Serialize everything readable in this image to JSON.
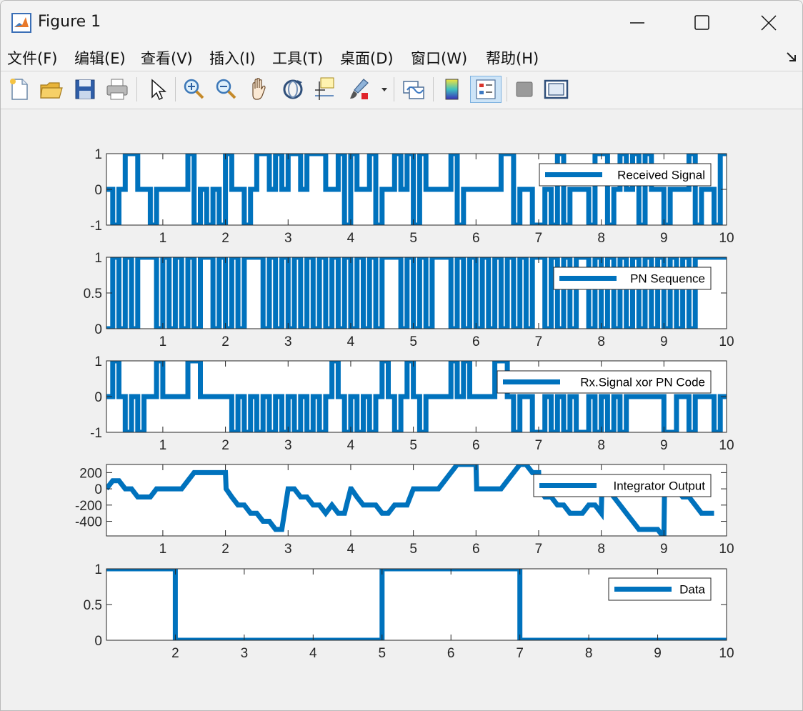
{
  "window": {
    "title": "Figure 1",
    "minimize_icon": "minimize-icon",
    "maximize_icon": "maximize-icon",
    "close_icon": "close-icon"
  },
  "menubar": {
    "items": [
      {
        "label": "文件(F)"
      },
      {
        "label": "编辑(E)"
      },
      {
        "label": "查看(V)"
      },
      {
        "label": "插入(I)"
      },
      {
        "label": "工具(T)"
      },
      {
        "label": "桌面(D)"
      },
      {
        "label": "窗口(W)"
      },
      {
        "label": "帮助(H)"
      }
    ]
  },
  "toolbar": {
    "buttons": [
      {
        "name": "new-figure-icon"
      },
      {
        "name": "open-file-icon"
      },
      {
        "name": "save-icon"
      },
      {
        "name": "print-icon"
      },
      {
        "name": "edit-plot-arrow-icon"
      },
      {
        "name": "zoom-in-icon"
      },
      {
        "name": "zoom-out-icon"
      },
      {
        "name": "pan-hand-icon"
      },
      {
        "name": "rotate-3d-icon"
      },
      {
        "name": "data-cursor-icon"
      },
      {
        "name": "brush-icon"
      },
      {
        "name": "link-plot-icon"
      },
      {
        "name": "colorbar-icon"
      },
      {
        "name": "legend-icon"
      },
      {
        "name": "hide-plot-tools-icon"
      },
      {
        "name": "show-plot-tools-icon"
      }
    ]
  },
  "colors": {
    "line": "#0072bd",
    "axes_bg": "#ffffff",
    "figure_bg": "#f0f0f0",
    "axis_color": "#262626"
  },
  "chart_data": [
    {
      "type": "line",
      "legend": "Received Signal",
      "legend_position": "top-right",
      "xlim": [
        0.1,
        10
      ],
      "ylim": [
        -1,
        1
      ],
      "xticks": [
        1,
        2,
        3,
        4,
        5,
        6,
        7,
        8,
        9,
        10
      ],
      "yticks": [
        -1,
        0,
        1
      ],
      "ytick_labels": [
        "-1",
        "0",
        "1"
      ],
      "x": [
        0.1,
        0.2,
        0.3,
        0.4,
        0.5,
        0.6,
        0.7,
        0.8,
        0.9,
        1.0,
        1.1,
        1.2,
        1.3,
        1.4,
        1.5,
        1.6,
        1.7,
        1.8,
        1.9,
        2.0,
        2.1,
        2.2,
        2.3,
        2.4,
        2.5,
        2.6,
        2.7,
        2.8,
        2.9,
        3.0,
        3.1,
        3.2,
        3.3,
        3.4,
        3.5,
        3.6,
        3.7,
        3.8,
        3.9,
        4.0,
        4.1,
        4.2,
        4.3,
        4.4,
        4.5,
        4.6,
        4.7,
        4.8,
        4.9,
        5.0,
        5.1,
        5.2,
        5.3,
        5.4,
        5.5,
        5.6,
        5.7,
        5.8,
        5.9,
        6.0,
        6.1,
        6.2,
        6.3,
        6.4,
        6.5,
        6.6,
        6.7,
        6.8,
        6.9,
        7.0,
        7.1,
        7.2,
        7.3,
        7.4,
        7.5,
        7.6,
        7.7,
        7.8,
        7.9,
        8.0,
        8.1,
        8.2,
        8.3,
        8.4,
        8.5,
        8.6,
        8.7,
        8.8,
        8.9,
        9.0,
        9.1,
        9.2,
        9.3,
        9.4,
        9.5,
        9.6,
        9.7,
        9.8,
        9.9,
        10.0
      ],
      "y": [
        0,
        -1,
        0,
        1,
        1,
        0,
        0,
        -1,
        0,
        0,
        0,
        0,
        0,
        1,
        -1,
        0,
        -1,
        0,
        -1,
        1,
        0,
        0,
        -1,
        0,
        1,
        1,
        0,
        1,
        0,
        1,
        1,
        0,
        1,
        1,
        1,
        0,
        0,
        1,
        -1,
        1,
        0,
        0,
        1,
        -1,
        0,
        0,
        1,
        0,
        1,
        -1,
        1,
        0,
        0,
        0,
        0,
        1,
        -1,
        0,
        0,
        0,
        0,
        0,
        0,
        1,
        1,
        -1,
        0,
        0,
        -1,
        -1,
        0,
        -1,
        1,
        -1,
        0,
        0,
        0,
        -1,
        1,
        1,
        -1,
        0,
        1,
        0,
        1,
        -1,
        1,
        0,
        0,
        -1,
        0,
        0,
        0,
        1,
        -1,
        0,
        0,
        -1,
        1,
        1
      ]
    },
    {
      "type": "line",
      "legend": "PN Sequence",
      "legend_position": "top-right",
      "xlim": [
        0.1,
        10
      ],
      "ylim": [
        0,
        1
      ],
      "xticks": [
        1,
        2,
        3,
        4,
        5,
        6,
        7,
        8,
        9,
        10
      ],
      "yticks": [
        0,
        0.5,
        1
      ],
      "ytick_labels": [
        "0",
        "0.5",
        "1"
      ],
      "x": [
        0.1,
        0.2,
        0.3,
        0.4,
        0.5,
        0.6,
        0.7,
        0.8,
        0.9,
        1.0,
        1.1,
        1.2,
        1.3,
        1.4,
        1.5,
        1.6,
        1.7,
        1.8,
        1.9,
        2.0,
        2.1,
        2.2,
        2.3,
        2.4,
        2.5,
        2.6,
        2.7,
        2.8,
        2.9,
        3.0,
        3.1,
        3.2,
        3.3,
        3.4,
        3.5,
        3.6,
        3.7,
        3.8,
        3.9,
        4.0,
        4.1,
        4.2,
        4.3,
        4.4,
        4.5,
        4.6,
        4.7,
        4.8,
        4.9,
        5.0,
        5.1,
        5.2,
        5.3,
        5.4,
        5.5,
        5.6,
        5.7,
        5.8,
        5.9,
        6.0,
        6.1,
        6.2,
        6.3,
        6.4,
        6.5,
        6.6,
        6.7,
        6.8,
        6.9,
        7.0,
        7.1,
        7.2,
        7.3,
        7.4,
        7.5,
        7.6,
        7.7,
        7.8,
        7.9,
        8.0,
        8.1,
        8.2,
        8.3,
        8.4,
        8.5,
        8.6,
        8.7,
        8.8,
        8.9,
        9.0,
        9.1,
        9.2,
        9.3,
        9.4,
        9.5,
        9.6,
        9.7,
        9.8,
        9.9,
        10.0
      ],
      "y": [
        0,
        1,
        0,
        1,
        0,
        1,
        1,
        1,
        0,
        1,
        0,
        1,
        0,
        1,
        0,
        1,
        1,
        0,
        1,
        0,
        1,
        0,
        1,
        1,
        1,
        0,
        1,
        0,
        1,
        0,
        1,
        0,
        1,
        0,
        1,
        0,
        1,
        0,
        1,
        0,
        1,
        0,
        1,
        0,
        1,
        1,
        1,
        0,
        1,
        0,
        1,
        0,
        1,
        1,
        1,
        0,
        1,
        0,
        1,
        0,
        1,
        0,
        1,
        0,
        1,
        0,
        1,
        0,
        1,
        1,
        0,
        1,
        0,
        1,
        0,
        1,
        1,
        0,
        1,
        0,
        1,
        0,
        1,
        0,
        1,
        0,
        1,
        0,
        1,
        0,
        1,
        0,
        1,
        0,
        1,
        1,
        1,
        1,
        1,
        1
      ]
    },
    {
      "type": "line",
      "legend": "Rx.Signal xor PN Code",
      "legend_position": "top-right",
      "xlim": [
        0.1,
        10
      ],
      "ylim": [
        -1,
        1
      ],
      "xticks": [
        1,
        2,
        3,
        4,
        5,
        6,
        7,
        8,
        9,
        10
      ],
      "yticks": [
        -1,
        0,
        1
      ],
      "ytick_labels": [
        "-1",
        "0",
        "1"
      ],
      "x": [
        0.1,
        0.2,
        0.3,
        0.4,
        0.5,
        0.6,
        0.7,
        0.8,
        0.9,
        1.0,
        1.1,
        1.2,
        1.3,
        1.4,
        1.5,
        1.6,
        1.7,
        1.8,
        1.9,
        2.0,
        2.1,
        2.2,
        2.3,
        2.4,
        2.5,
        2.6,
        2.7,
        2.8,
        2.9,
        3.0,
        3.1,
        3.2,
        3.3,
        3.4,
        3.5,
        3.6,
        3.7,
        3.8,
        3.9,
        4.0,
        4.1,
        4.2,
        4.3,
        4.4,
        4.5,
        4.6,
        4.7,
        4.8,
        4.9,
        5.0,
        5.1,
        5.2,
        5.3,
        5.4,
        5.5,
        5.6,
        5.7,
        5.8,
        5.9,
        6.0,
        6.1,
        6.2,
        6.3,
        6.4,
        6.5,
        6.6,
        6.7,
        6.8,
        6.9,
        7.0,
        7.1,
        7.2,
        7.3,
        7.4,
        7.5,
        7.6,
        7.7,
        7.8,
        7.9,
        8.0,
        8.1,
        8.2,
        8.3,
        8.4,
        8.5,
        8.6,
        8.7,
        8.8,
        8.9,
        9.0,
        9.1,
        9.2,
        9.3,
        9.4,
        9.5,
        9.6,
        9.7,
        9.8,
        9.9,
        10.0
      ],
      "y": [
        0,
        1,
        0,
        -1,
        0,
        -1,
        0,
        0,
        1,
        0,
        0,
        0,
        0,
        1,
        1,
        0,
        0,
        0,
        0,
        0,
        -1,
        0,
        -1,
        0,
        -1,
        0,
        -1,
        0,
        -1,
        0,
        -1,
        0,
        -1,
        0,
        -1,
        0,
        1,
        0,
        -1,
        0,
        -1,
        0,
        -1,
        0,
        1,
        0,
        -1,
        0,
        1,
        0,
        -1,
        0,
        0,
        0,
        0,
        1,
        0,
        1,
        0,
        0,
        0,
        0,
        1,
        1,
        0,
        -1,
        0,
        0,
        -1,
        -1,
        0,
        -1,
        0,
        -1,
        0,
        -1,
        -1,
        0,
        -1,
        0,
        -1,
        0,
        -1,
        0,
        0,
        0,
        0,
        0,
        0,
        -1,
        -1,
        0,
        0,
        -1,
        0,
        0,
        0,
        -1,
        0,
        0
      ]
    },
    {
      "type": "line",
      "legend": "Integrator Output",
      "legend_position": "top-right",
      "xlim": [
        0.1,
        10
      ],
      "ylim": [
        -580,
        300
      ],
      "xticks": [
        1,
        2,
        3,
        4,
        5,
        6,
        7,
        8,
        9,
        10
      ],
      "yticks": [
        200,
        0,
        -200,
        -400
      ],
      "ytick_labels": [
        "200",
        "0",
        "-200",
        "-400"
      ],
      "x": [
        0.1,
        0.2,
        0.3,
        0.4,
        0.5,
        0.6,
        0.7,
        0.8,
        0.9,
        1.0,
        1.1,
        1.2,
        1.3,
        1.4,
        1.5,
        1.6,
        1.7,
        1.8,
        1.9,
        2.0,
        2.01,
        2.1,
        2.2,
        2.3,
        2.4,
        2.5,
        2.6,
        2.7,
        2.8,
        2.9,
        3.0,
        3.01,
        3.1,
        3.2,
        3.3,
        3.4,
        3.5,
        3.6,
        3.7,
        3.8,
        3.9,
        4.0,
        4.01,
        4.1,
        4.2,
        4.3,
        4.4,
        4.5,
        4.6,
        4.7,
        4.8,
        4.9,
        5.0,
        5.01,
        5.1,
        5.2,
        5.3,
        5.4,
        5.5,
        5.6,
        5.7,
        5.8,
        5.9,
        6.0,
        6.01,
        6.1,
        6.2,
        6.3,
        6.4,
        6.5,
        6.6,
        6.7,
        6.8,
        6.9,
        7.0,
        7.01,
        7.1,
        7.2,
        7.3,
        7.4,
        7.5,
        7.6,
        7.7,
        7.8,
        7.9,
        8.0,
        8.01,
        8.1,
        8.2,
        8.3,
        8.4,
        8.5,
        8.6,
        8.7,
        8.8,
        8.9,
        9.0,
        9.01,
        9.1,
        9.2,
        9.3,
        9.4,
        9.5,
        9.6,
        9.7,
        9.8,
        9.9,
        10.0
      ],
      "y": [
        0,
        100,
        100,
        0,
        0,
        -100,
        -100,
        -100,
        0,
        0,
        0,
        0,
        0,
        100,
        200,
        200,
        200,
        200,
        200,
        200,
        0,
        -100,
        -200,
        -200,
        -300,
        -300,
        -400,
        -400,
        -500,
        -500,
        0,
        0,
        0,
        -100,
        -100,
        -200,
        -200,
        -300,
        -200,
        -300,
        -300,
        0,
        0,
        -100,
        -200,
        -200,
        -200,
        -300,
        -300,
        -200,
        -200,
        -200,
        0,
        0,
        0,
        0,
        0,
        0,
        100,
        200,
        300,
        300,
        300,
        300,
        0,
        0,
        0,
        0,
        0,
        100,
        200,
        300,
        300,
        200,
        200,
        0,
        -100,
        -100,
        -200,
        -200,
        -300,
        -300,
        -300,
        -200,
        -200,
        -300,
        0,
        0,
        -100,
        -200,
        -300,
        -400,
        -500,
        -500,
        -500,
        -500,
        -600,
        0,
        0,
        0,
        -100,
        -100,
        -200,
        -300,
        -300,
        -300
      ]
    },
    {
      "type": "line",
      "legend": "Data",
      "legend_position": "top-right",
      "xlim": [
        1,
        10
      ],
      "ylim": [
        0,
        1
      ],
      "xticks": [
        2,
        3,
        4,
        5,
        6,
        7,
        8,
        9,
        10
      ],
      "yticks": [
        0,
        0.5,
        1
      ],
      "ytick_labels": [
        "0",
        "0.5",
        "1"
      ],
      "x": [
        1,
        2,
        2,
        5,
        5,
        7,
        7,
        10
      ],
      "y": [
        1,
        1,
        0,
        0,
        1,
        1,
        0,
        0
      ]
    }
  ]
}
